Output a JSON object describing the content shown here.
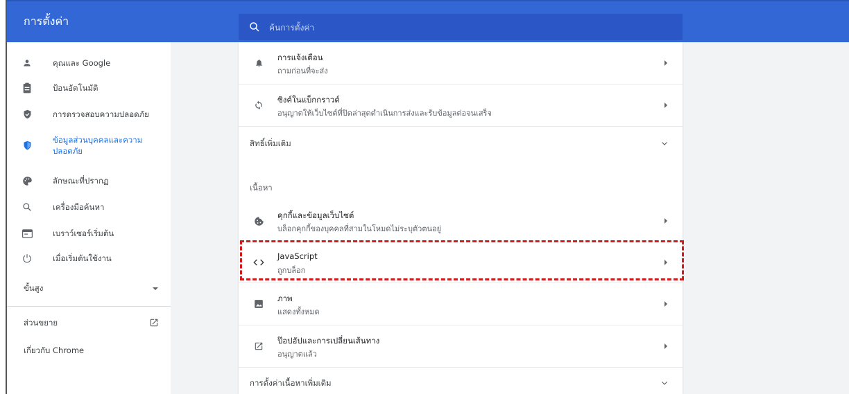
{
  "header": {
    "title": "การตั้งค่า",
    "search_placeholder": "ค้นการตั้งค่า"
  },
  "sidebar": {
    "items": [
      {
        "label": "คุณและ Google",
        "icon": "person-icon"
      },
      {
        "label": "ป้อนอัตโนมัติ",
        "icon": "clipboard-icon"
      },
      {
        "label": "การตรวจสอบความปลอดภัย",
        "icon": "shield-check-icon"
      },
      {
        "label": "ข้อมูลส่วนบุคคลและความปลอดภัย",
        "icon": "shield-icon",
        "active": true
      },
      {
        "label": "ลักษณะที่ปรากฏ",
        "icon": "palette-icon"
      },
      {
        "label": "เครื่องมือค้นหา",
        "icon": "search-icon"
      },
      {
        "label": "เบราว์เซอร์เริ่มต้น",
        "icon": "browser-icon"
      },
      {
        "label": "เมื่อเริ่มต้นใช้งาน",
        "icon": "power-icon"
      }
    ],
    "advanced_label": "ขั้นสูง",
    "extensions_label": "ส่วนขยาย",
    "about_label": "เกี่ยวกับ Chrome"
  },
  "main": {
    "rows": [
      {
        "title": "การแจ้งเตือน",
        "subtitle": "ถามก่อนที่จะส่ง",
        "icon": "bell-icon"
      },
      {
        "title": "ซิงค์ในแบ็กกราวด์",
        "subtitle": "อนุญาตให้เว็บไซต์ที่ปิดล่าสุดดำเนินการส่งและรับข้อมูลต่อจนเสร็จ",
        "icon": "sync-icon"
      }
    ],
    "additional_permissions_label": "สิทธิ์เพิ่มเติม",
    "content_section_label": "เนื้อหา",
    "content_rows": [
      {
        "title": "คุกกี้และข้อมูลเว็บไซต์",
        "subtitle": "บล็อกคุกกี้ของบุคคลที่สามในโหมดไม่ระบุตัวตนอยู่",
        "icon": "cookie-icon"
      },
      {
        "title": "JavaScript",
        "subtitle": "ถูกบล็อก",
        "icon": "code-icon"
      },
      {
        "title": "ภาพ",
        "subtitle": "แสดงทั้งหมด",
        "icon": "image-icon"
      },
      {
        "title": "ป๊อปอัปและการเปลี่ยนเส้นทาง",
        "subtitle": "อนุญาตแล้ว",
        "icon": "popup-icon"
      }
    ],
    "additional_content_label": "การตั้งค่าเนื้อหาเพิ่มเติม"
  },
  "colors": {
    "header_bg": "#3367d6",
    "accent": "#1a73e8",
    "highlight": "#d01c1c"
  }
}
